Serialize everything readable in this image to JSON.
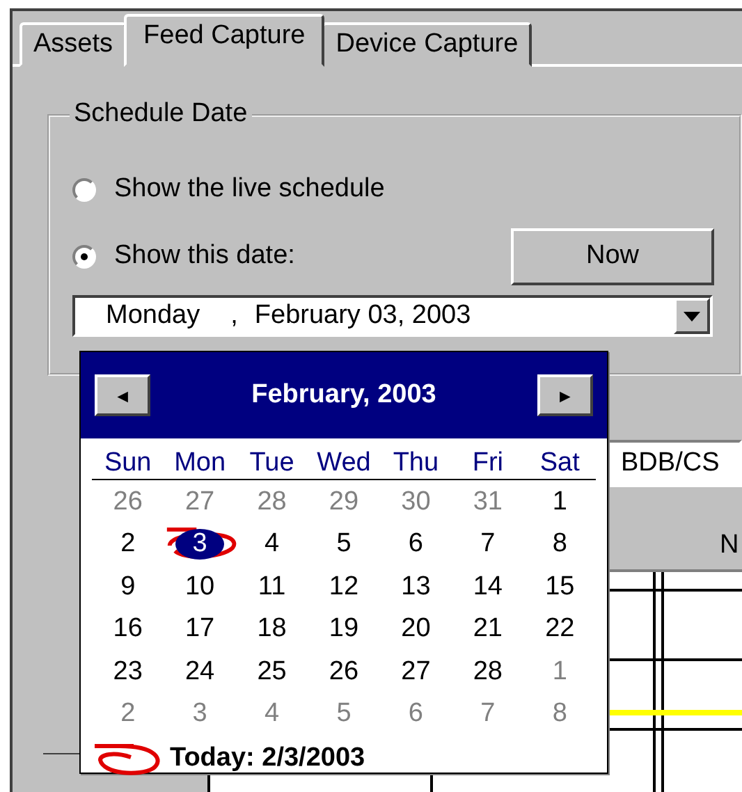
{
  "tabs": [
    {
      "label": "Assets",
      "selected": false
    },
    {
      "label": "Feed Capture",
      "selected": true
    },
    {
      "label": "Device Capture",
      "selected": false
    }
  ],
  "schedule_date": {
    "title": "Schedule Date",
    "radios": [
      {
        "label": "Show the live schedule",
        "selected": false
      },
      {
        "label": "Show this date:",
        "selected": true
      }
    ],
    "now_button": "Now",
    "date_field": {
      "weekday": "Monday",
      "separator": ",",
      "date": "February  03, 2003"
    }
  },
  "background": {
    "path_field": "BDB/CS",
    "column_header": "N"
  },
  "calendar": {
    "title": "February, 2003",
    "prev": "◄",
    "next": "►",
    "weekdays": [
      "Sun",
      "Mon",
      "Tue",
      "Wed",
      "Thu",
      "Fri",
      "Sat"
    ],
    "weeks": [
      [
        {
          "day": "26",
          "outside": true,
          "selected": false
        },
        {
          "day": "27",
          "outside": true,
          "selected": false
        },
        {
          "day": "28",
          "outside": true,
          "selected": false
        },
        {
          "day": "29",
          "outside": true,
          "selected": false
        },
        {
          "day": "30",
          "outside": true,
          "selected": false
        },
        {
          "day": "31",
          "outside": true,
          "selected": false
        },
        {
          "day": "1",
          "outside": false,
          "selected": false
        }
      ],
      [
        {
          "day": "2",
          "outside": false,
          "selected": false
        },
        {
          "day": "3",
          "outside": false,
          "selected": true
        },
        {
          "day": "4",
          "outside": false,
          "selected": false
        },
        {
          "day": "5",
          "outside": false,
          "selected": false
        },
        {
          "day": "6",
          "outside": false,
          "selected": false
        },
        {
          "day": "7",
          "outside": false,
          "selected": false
        },
        {
          "day": "8",
          "outside": false,
          "selected": false
        }
      ],
      [
        {
          "day": "9",
          "outside": false,
          "selected": false
        },
        {
          "day": "10",
          "outside": false,
          "selected": false
        },
        {
          "day": "11",
          "outside": false,
          "selected": false
        },
        {
          "day": "12",
          "outside": false,
          "selected": false
        },
        {
          "day": "13",
          "outside": false,
          "selected": false
        },
        {
          "day": "14",
          "outside": false,
          "selected": false
        },
        {
          "day": "15",
          "outside": false,
          "selected": false
        }
      ],
      [
        {
          "day": "16",
          "outside": false,
          "selected": false
        },
        {
          "day": "17",
          "outside": false,
          "selected": false
        },
        {
          "day": "18",
          "outside": false,
          "selected": false
        },
        {
          "day": "19",
          "outside": false,
          "selected": false
        },
        {
          "day": "20",
          "outside": false,
          "selected": false
        },
        {
          "day": "21",
          "outside": false,
          "selected": false
        },
        {
          "day": "22",
          "outside": false,
          "selected": false
        }
      ],
      [
        {
          "day": "23",
          "outside": false,
          "selected": false
        },
        {
          "day": "24",
          "outside": false,
          "selected": false
        },
        {
          "day": "25",
          "outside": false,
          "selected": false
        },
        {
          "day": "26",
          "outside": false,
          "selected": false
        },
        {
          "day": "27",
          "outside": false,
          "selected": false
        },
        {
          "day": "28",
          "outside": false,
          "selected": false
        },
        {
          "day": "1",
          "outside": true,
          "selected": false
        }
      ],
      [
        {
          "day": "2",
          "outside": true,
          "selected": false
        },
        {
          "day": "3",
          "outside": true,
          "selected": false
        },
        {
          "day": "4",
          "outside": true,
          "selected": false
        },
        {
          "day": "5",
          "outside": true,
          "selected": false
        },
        {
          "day": "6",
          "outside": true,
          "selected": false
        },
        {
          "day": "7",
          "outside": true,
          "selected": false
        },
        {
          "day": "8",
          "outside": true,
          "selected": false
        }
      ]
    ],
    "today": "Today: 2/3/2003"
  }
}
